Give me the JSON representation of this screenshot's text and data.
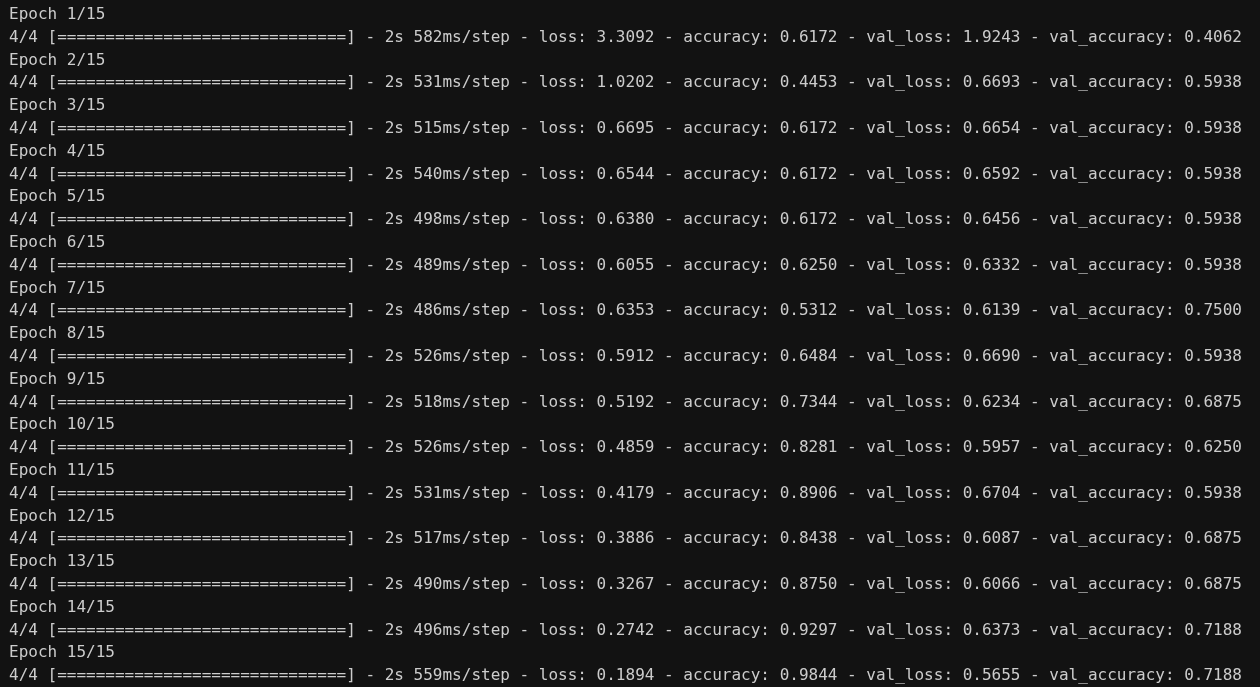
{
  "epochs": [
    {
      "header": "Epoch 1/15",
      "progress": "4/4 [==============================] - 2s 582ms/step - loss: 3.3092 - accuracy: 0.6172 - val_loss: 1.9243 - val_accuracy: 0.4062"
    },
    {
      "header": "Epoch 2/15",
      "progress": "4/4 [==============================] - 2s 531ms/step - loss: 1.0202 - accuracy: 0.4453 - val_loss: 0.6693 - val_accuracy: 0.5938"
    },
    {
      "header": "Epoch 3/15",
      "progress": "4/4 [==============================] - 2s 515ms/step - loss: 0.6695 - accuracy: 0.6172 - val_loss: 0.6654 - val_accuracy: 0.5938"
    },
    {
      "header": "Epoch 4/15",
      "progress": "4/4 [==============================] - 2s 540ms/step - loss: 0.6544 - accuracy: 0.6172 - val_loss: 0.6592 - val_accuracy: 0.5938"
    },
    {
      "header": "Epoch 5/15",
      "progress": "4/4 [==============================] - 2s 498ms/step - loss: 0.6380 - accuracy: 0.6172 - val_loss: 0.6456 - val_accuracy: 0.5938"
    },
    {
      "header": "Epoch 6/15",
      "progress": "4/4 [==============================] - 2s 489ms/step - loss: 0.6055 - accuracy: 0.6250 - val_loss: 0.6332 - val_accuracy: 0.5938"
    },
    {
      "header": "Epoch 7/15",
      "progress": "4/4 [==============================] - 2s 486ms/step - loss: 0.6353 - accuracy: 0.5312 - val_loss: 0.6139 - val_accuracy: 0.7500"
    },
    {
      "header": "Epoch 8/15",
      "progress": "4/4 [==============================] - 2s 526ms/step - loss: 0.5912 - accuracy: 0.6484 - val_loss: 0.6690 - val_accuracy: 0.5938"
    },
    {
      "header": "Epoch 9/15",
      "progress": "4/4 [==============================] - 2s 518ms/step - loss: 0.5192 - accuracy: 0.7344 - val_loss: 0.6234 - val_accuracy: 0.6875"
    },
    {
      "header": "Epoch 10/15",
      "progress": "4/4 [==============================] - 2s 526ms/step - loss: 0.4859 - accuracy: 0.8281 - val_loss: 0.5957 - val_accuracy: 0.6250"
    },
    {
      "header": "Epoch 11/15",
      "progress": "4/4 [==============================] - 2s 531ms/step - loss: 0.4179 - accuracy: 0.8906 - val_loss: 0.6704 - val_accuracy: 0.5938"
    },
    {
      "header": "Epoch 12/15",
      "progress": "4/4 [==============================] - 2s 517ms/step - loss: 0.3886 - accuracy: 0.8438 - val_loss: 0.6087 - val_accuracy: 0.6875"
    },
    {
      "header": "Epoch 13/15",
      "progress": "4/4 [==============================] - 2s 490ms/step - loss: 0.3267 - accuracy: 0.8750 - val_loss: 0.6066 - val_accuracy: 0.6875"
    },
    {
      "header": "Epoch 14/15",
      "progress": "4/4 [==============================] - 2s 496ms/step - loss: 0.2742 - accuracy: 0.9297 - val_loss: 0.6373 - val_accuracy: 0.7188"
    },
    {
      "header": "Epoch 15/15",
      "progress": "4/4 [==============================] - 2s 559ms/step - loss: 0.1894 - accuracy: 0.9844 - val_loss: 0.5655 - val_accuracy: 0.7188"
    }
  ]
}
